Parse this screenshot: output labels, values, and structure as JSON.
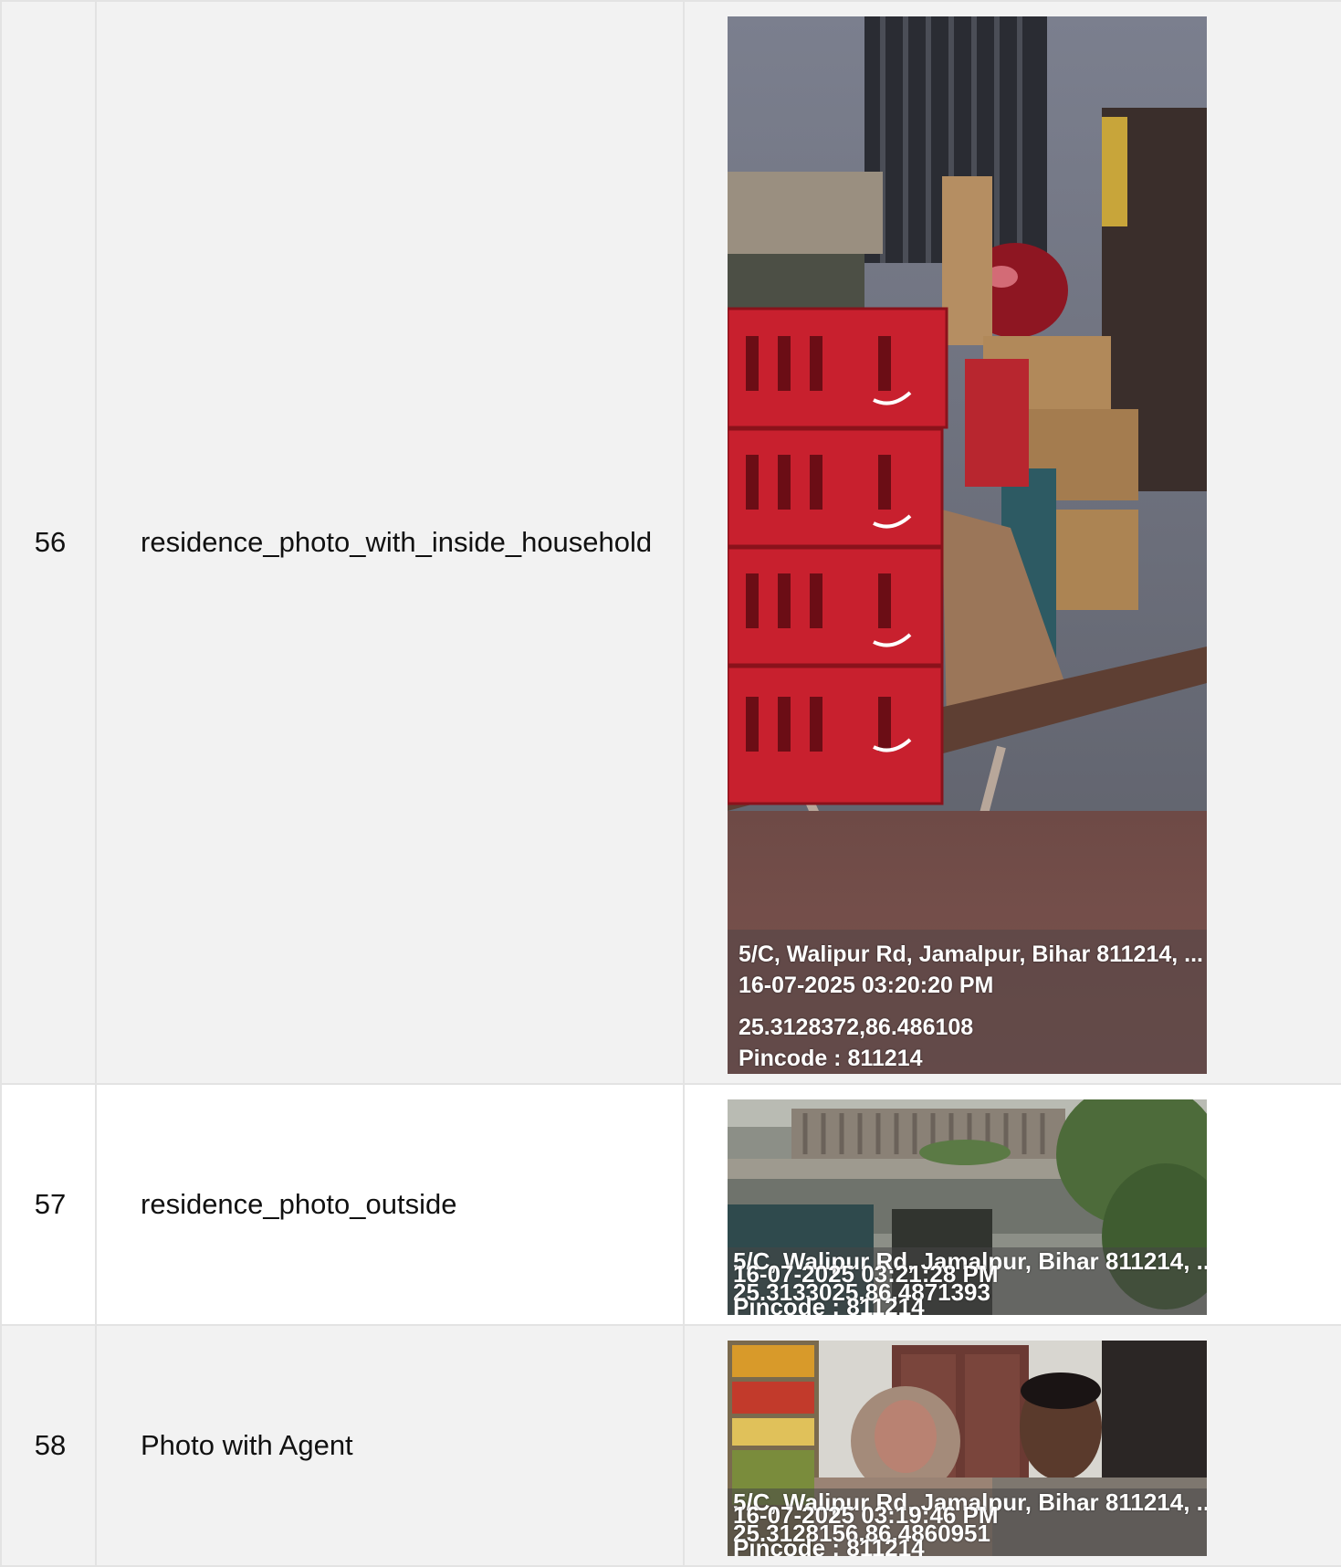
{
  "rows": [
    {
      "number": "56",
      "label": "residence_photo_with_inside_household",
      "photo": {
        "description_icon": "household-interior-photo",
        "address": "5/C, Walipur Rd, Jamalpur, Bihar 811214, ...",
        "datetime": "16-07-2025 03:20:20 PM",
        "coordinates": "25.3128372,86.486108",
        "pincode": "Pincode : 811214"
      }
    },
    {
      "number": "57",
      "label": "residence_photo_outside",
      "photo": {
        "description_icon": "house-exterior-photo",
        "address": "5/C, Walipur Rd, Jamalpur, Bihar 811214, ...",
        "datetime": "16-07-2025 03:21:28 PM",
        "coordinates": "25.3133025,86.4871393",
        "pincode": "Pincode : 811214"
      }
    },
    {
      "number": "58",
      "label": "Photo with Agent",
      "photo": {
        "description_icon": "agent-selfie-photo",
        "address": "5/C, Walipur Rd, Jamalpur, Bihar 811214, ...",
        "datetime": "16-07-2025 03:19:46 PM",
        "coordinates": "25.3128156,86.4860951",
        "pincode": "Pincode : 811214"
      }
    }
  ],
  "colors": {
    "row_shade": "#f2f2f2",
    "row_plain": "#ffffff",
    "border": "#e3e3e3",
    "crate_red": "#c8202e"
  }
}
